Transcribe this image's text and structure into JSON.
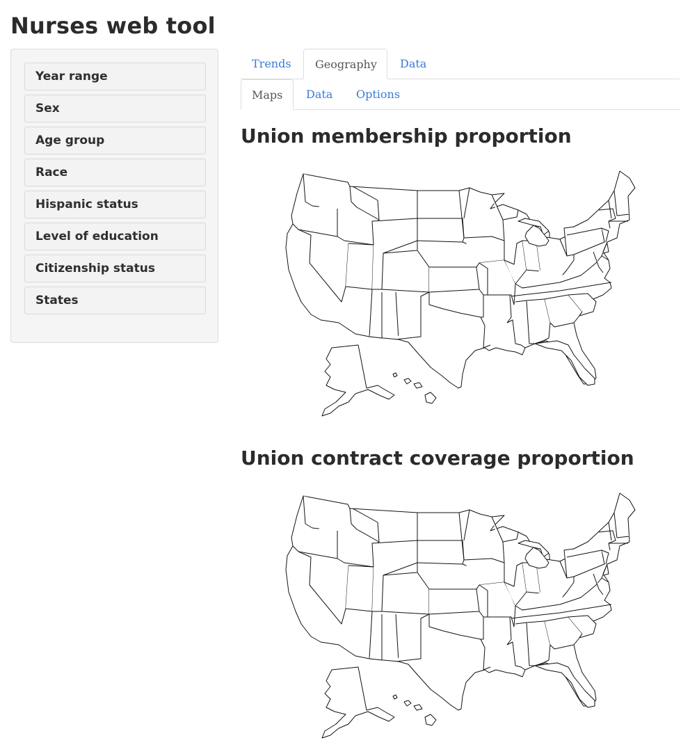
{
  "app": {
    "title": "Nurses web tool"
  },
  "sidebar": {
    "items": [
      {
        "label": "Year range"
      },
      {
        "label": "Sex"
      },
      {
        "label": "Age group"
      },
      {
        "label": "Race"
      },
      {
        "label": "Hispanic status"
      },
      {
        "label": "Level of education"
      },
      {
        "label": "Citizenship status"
      },
      {
        "label": "States"
      }
    ]
  },
  "tabs": {
    "main": [
      {
        "label": "Trends",
        "active": false
      },
      {
        "label": "Geography",
        "active": true
      },
      {
        "label": "Data",
        "active": false
      }
    ],
    "sub": [
      {
        "label": "Maps",
        "active": true
      },
      {
        "label": "Data",
        "active": false
      },
      {
        "label": "Options",
        "active": false
      }
    ]
  },
  "maps": [
    {
      "title": "Union membership proportion"
    },
    {
      "title": "Union contract coverage proportion"
    }
  ]
}
